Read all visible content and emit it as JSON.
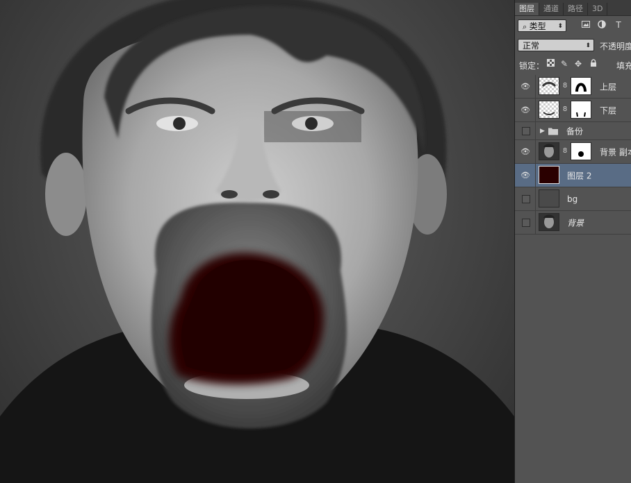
{
  "tabs": [
    {
      "label": "图层",
      "active": true
    },
    {
      "label": "通道",
      "active": false
    },
    {
      "label": "路径",
      "active": false
    },
    {
      "label": "3D",
      "active": false
    }
  ],
  "filter": {
    "type_label": "类型",
    "icons": [
      "image-filter-icon",
      "adjustment-filter-icon",
      "type-filter-icon"
    ]
  },
  "blend": {
    "mode": "正常",
    "opacity_label": "不透明度"
  },
  "lock": {
    "label": "锁定：",
    "fill_label": "填充",
    "icons": [
      "lock-transparent-icon",
      "lock-paint-icon",
      "lock-move-icon",
      "lock-all-icon"
    ]
  },
  "layers": [
    {
      "name": "上层",
      "visible": true,
      "selected": false,
      "kind": "masked-transparent"
    },
    {
      "name": "下层",
      "visible": true,
      "selected": false,
      "kind": "masked-transparent"
    },
    {
      "name": "备份",
      "visible": false,
      "selected": false,
      "kind": "group"
    },
    {
      "name": "背景 副本",
      "visible": true,
      "selected": false,
      "kind": "masked-photo"
    },
    {
      "name": "图层 2",
      "visible": true,
      "selected": true,
      "kind": "fill",
      "color": "#2a0000"
    },
    {
      "name": "bg",
      "visible": false,
      "selected": false,
      "kind": "fill",
      "color": "#4a4a4a"
    },
    {
      "name": "背景",
      "visible": false,
      "selected": false,
      "kind": "photo",
      "italic": true
    }
  ],
  "colors": {
    "selected_row": "#596c85",
    "mouth_fill": "#2a0000",
    "panel_bg": "#535353"
  }
}
